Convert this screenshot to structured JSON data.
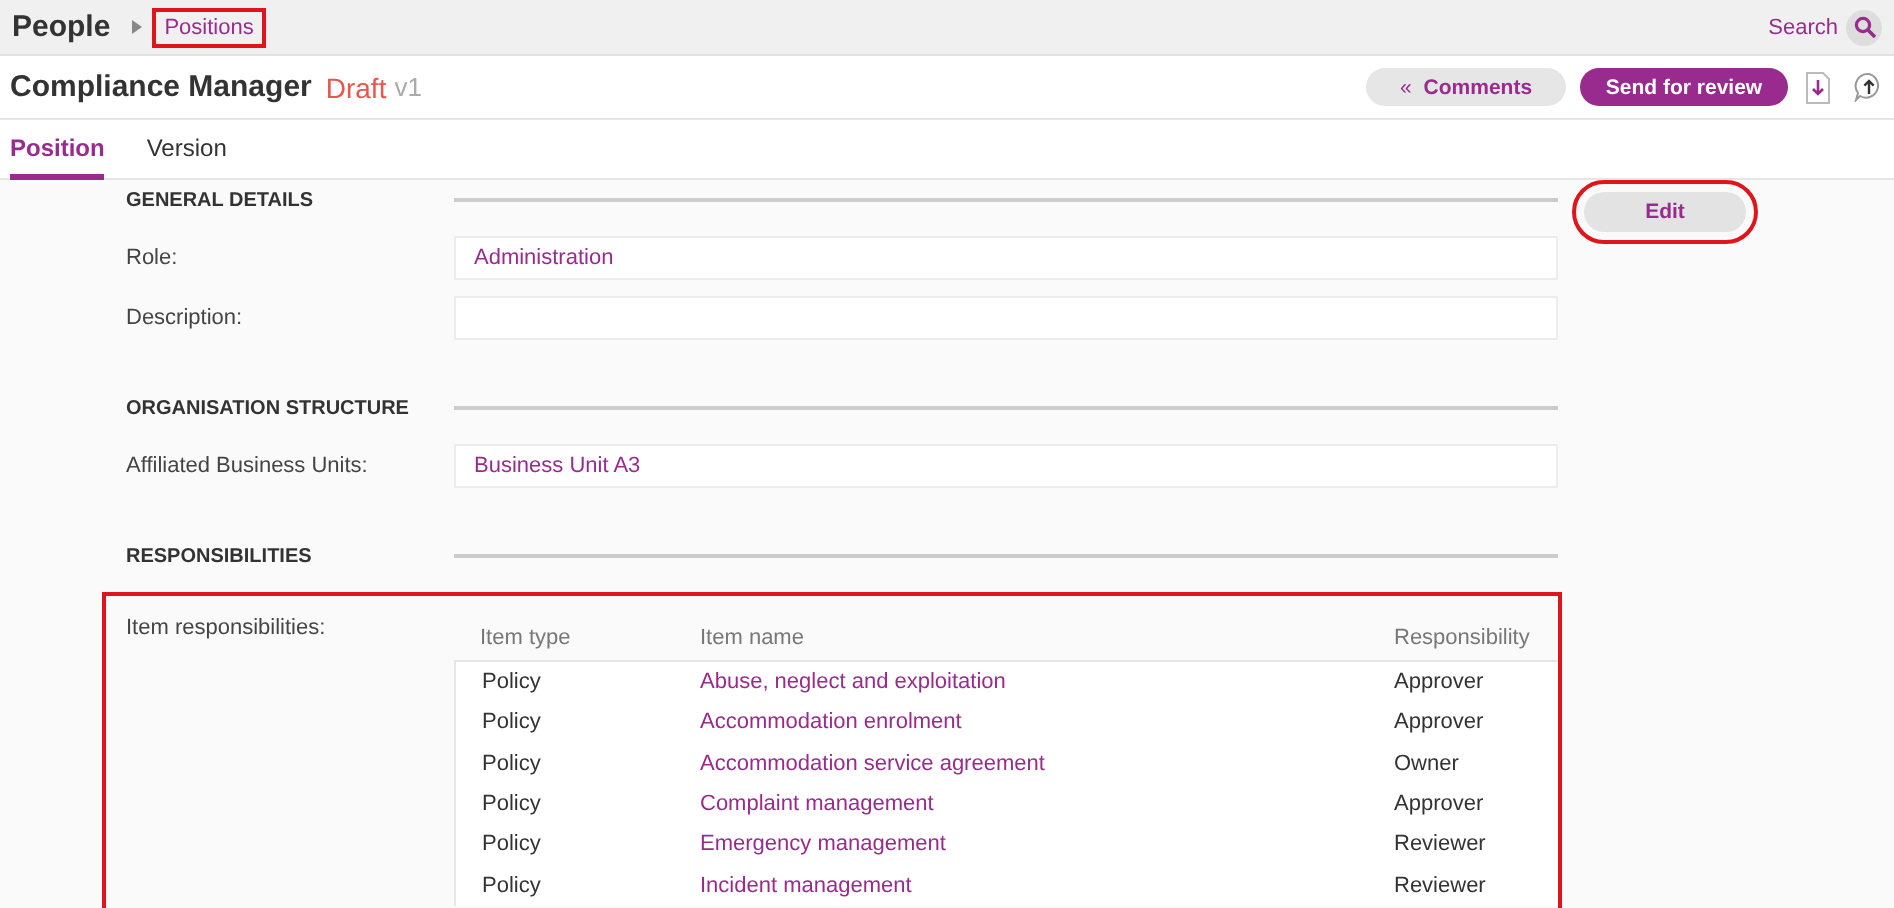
{
  "breadcrumb": {
    "root": "People",
    "current": "Positions",
    "highlighted": true
  },
  "search": {
    "label": "Search"
  },
  "header": {
    "title": "Compliance Manager",
    "status": "Draft",
    "version": "v1"
  },
  "actions": {
    "comments_icon": "«",
    "comments": "Comments",
    "submit": "Send for review"
  },
  "tabs": [
    {
      "label": "Position",
      "selected": true
    },
    {
      "label": "Version",
      "selected": false
    }
  ],
  "edit_button": {
    "label": "Edit",
    "highlighted": true
  },
  "sections": [
    {
      "title": "GENERAL DETAILS",
      "fields": [
        {
          "label": "Role:",
          "value": "Administration"
        },
        {
          "label": "Description:"
        }
      ]
    },
    {
      "title": "ORGANISATION STRUCTURE",
      "fields": [
        {
          "label": "Affiliated Business Units:",
          "value": "Business Unit A3"
        }
      ]
    },
    {
      "title": "RESPONSIBILITIES",
      "table": {
        "label": "Item responsibilities:",
        "highlighted": true,
        "columns": [
          "Item type",
          "Item name",
          "Responsibility"
        ],
        "rows": [
          [
            "Policy",
            "Abuse, neglect and exploitation",
            "Approver"
          ],
          [
            "Policy",
            "Accommodation enrolment",
            "Approver"
          ],
          [
            "Policy",
            "Accommodation service agreement",
            "Owner"
          ],
          [
            "Policy",
            "Complaint management",
            "Approver"
          ],
          [
            "Policy",
            "Emergency management",
            "Reviewer"
          ],
          [
            "Policy",
            "Incident management",
            "Reviewer"
          ]
        ]
      }
    }
  ]
}
